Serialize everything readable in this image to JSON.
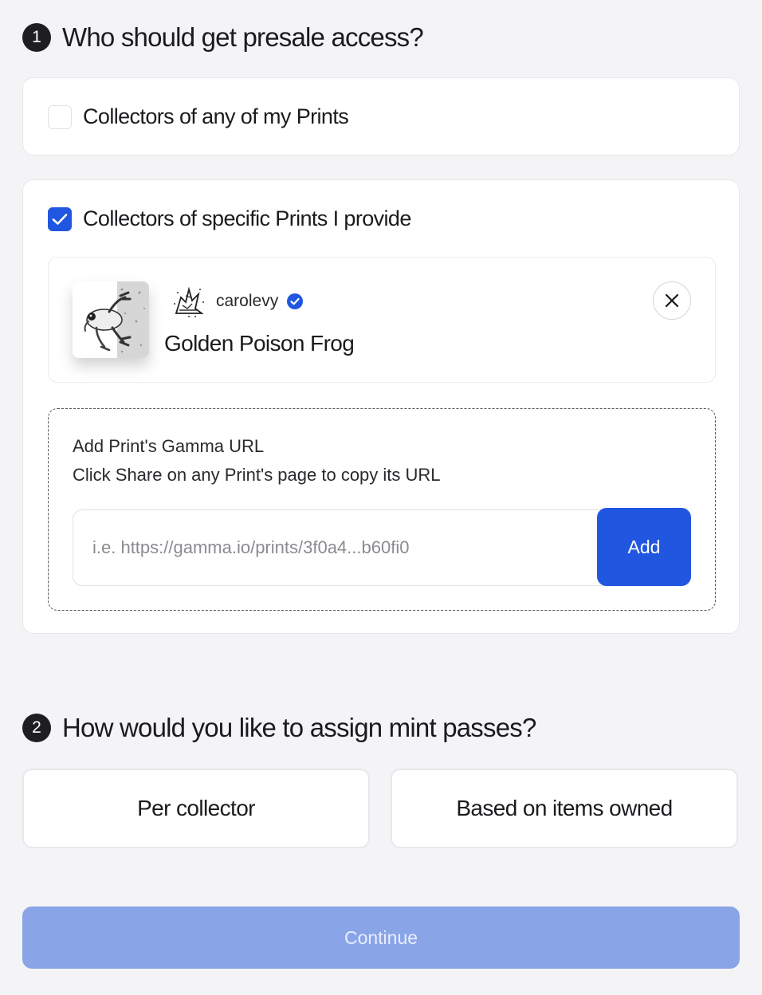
{
  "step1": {
    "number": "1",
    "title": "Who should get presale access?",
    "option_any": {
      "label": "Collectors of any of my Prints",
      "checked": false
    },
    "option_specific": {
      "label": "Collectors of specific Prints I provide",
      "checked": true
    }
  },
  "selected_print": {
    "creator": "carolevy",
    "verified": true,
    "title": "Golden Poison Frog",
    "thumbnail_icon": "frog-artwork-icon",
    "avatar_icon": "creator-avatar-icon",
    "remove_icon": "close-icon"
  },
  "url_entry": {
    "title": "Add Print's Gamma URL",
    "hint": "Click Share on any Print's page to copy its URL",
    "placeholder": "i.e. https://gamma.io/prints/3f0a4...b60fi0",
    "value": "",
    "add_label": "Add"
  },
  "step2": {
    "number": "2",
    "title": "How would you like to assign mint passes?",
    "options": [
      "Per collector",
      "Based on items owned"
    ]
  },
  "continue_label": "Continue",
  "colors": {
    "accent": "#2157e0",
    "continue_disabled": "#8aa4e8",
    "background": "#f4f4f6"
  }
}
